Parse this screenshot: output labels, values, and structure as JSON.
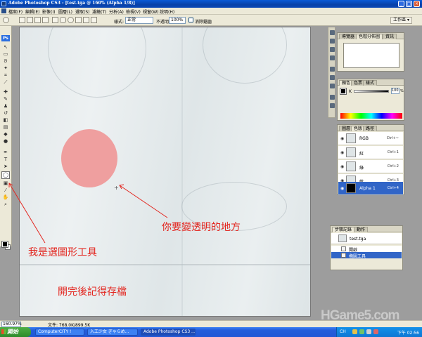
{
  "window": {
    "title": "Adobe Photoshop CS3 - [test.tga @ 160% (Alpha 1/8)]",
    "controls": [
      "_",
      "□",
      "×"
    ]
  },
  "menu": {
    "items": [
      "檔案(F)",
      "編輯(E)",
      "影像(I)",
      "圖層(L)",
      "選取(S)",
      "濾鏡(T)",
      "分析(A)",
      "檢視(V)",
      "視窗(W)",
      "說明(H)"
    ]
  },
  "options": {
    "style_label": "樣式:",
    "style_value": "正常",
    "opacity_label": "不透明",
    "opacity_value": "100%",
    "antialias_label": "消除鋸齒",
    "workspace_label": "工作區 ▾"
  },
  "panels": {
    "navigator_tabs": [
      "導覽器",
      "色階分佈圖",
      "資訊"
    ],
    "color_tabs": [
      "顏色",
      "色票",
      "樣式"
    ],
    "color": {
      "channel_label": "K",
      "value": "100",
      "unit": "%"
    },
    "channel_tabs": [
      "圖層",
      "色版",
      "路徑"
    ],
    "channels": [
      {
        "name": "RGB",
        "key": "Ctrl+~"
      },
      {
        "name": "紅",
        "key": "Ctrl+1"
      },
      {
        "name": "綠",
        "key": "Ctrl+2"
      },
      {
        "name": "藍",
        "key": "Ctrl+3"
      },
      {
        "name": "Alpha 1",
        "key": "Ctrl+4"
      }
    ],
    "history_tabs": [
      "步驟記錄",
      "動作"
    ],
    "history_snapshot": "test.tga",
    "history_steps": [
      "開啟",
      "橢圓工具"
    ]
  },
  "annotations": {
    "transparent_area": "你要變透明的地方",
    "tool_label": "我是選圖形工具",
    "save_hint": "開完後記得存檔"
  },
  "status": {
    "zoom": "160.97%",
    "doc": "文件: 768.0K/899.5K"
  },
  "taskbar": {
    "start": "開始",
    "tasks": [
      "ComputerCITY !",
      "入工少女 ぎゃらめ...",
      "Adobe Photoshop CS3 ..."
    ],
    "lang": "CH",
    "clock": "下午 02:56"
  },
  "watermark": "HGame5.com",
  "colors": {
    "annotation": "#e3261f",
    "circle": "#ef9f9f",
    "selection": "#3165c7",
    "titlebar": "#0a5bd6"
  }
}
